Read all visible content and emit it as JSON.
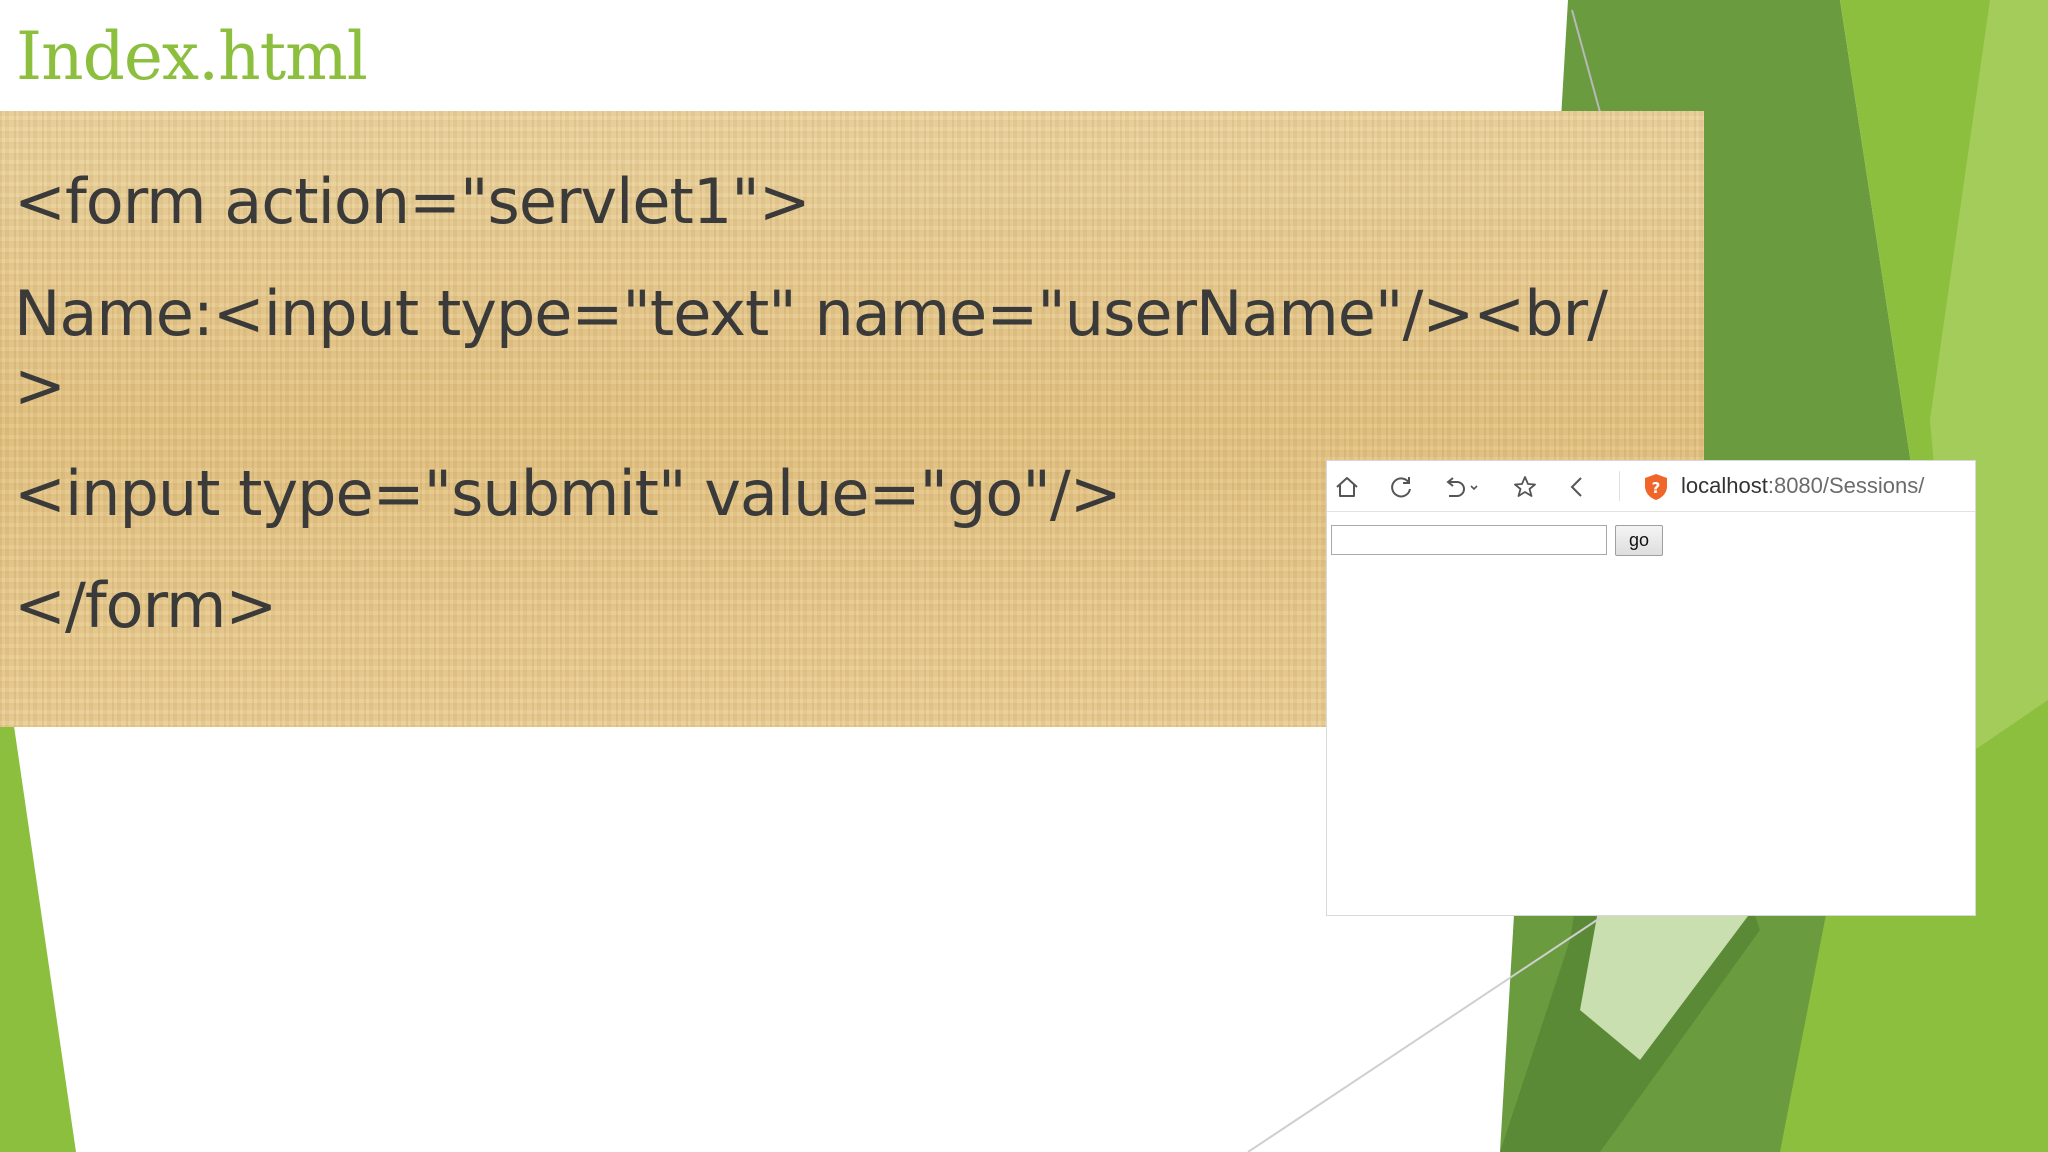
{
  "slide": {
    "title": "Index.html",
    "code_lines": [
      "<form action=\"servlet1\">",
      "Name:<input type=\"text\" name=\"userName\"/><br/",
      ">",
      "<input type=\"submit\" value=\"go\"/>",
      "</form>"
    ]
  },
  "browser": {
    "address_host": "localhost",
    "address_rest": ":8080/Sessions/",
    "toolbar_icons": [
      "home-icon",
      "reload-icon",
      "undo-icon",
      "star-icon",
      "back-icon",
      "shield-icon"
    ],
    "form": {
      "input_value": "",
      "submit_label": "go"
    }
  },
  "colors": {
    "title": "#8dbf3e",
    "green_light": "#8dbf3e",
    "green_mid": "#6a9b3f",
    "green_dark": "#4f7d32",
    "code_text": "#3a3a3a",
    "panel": "#e6c98c"
  }
}
